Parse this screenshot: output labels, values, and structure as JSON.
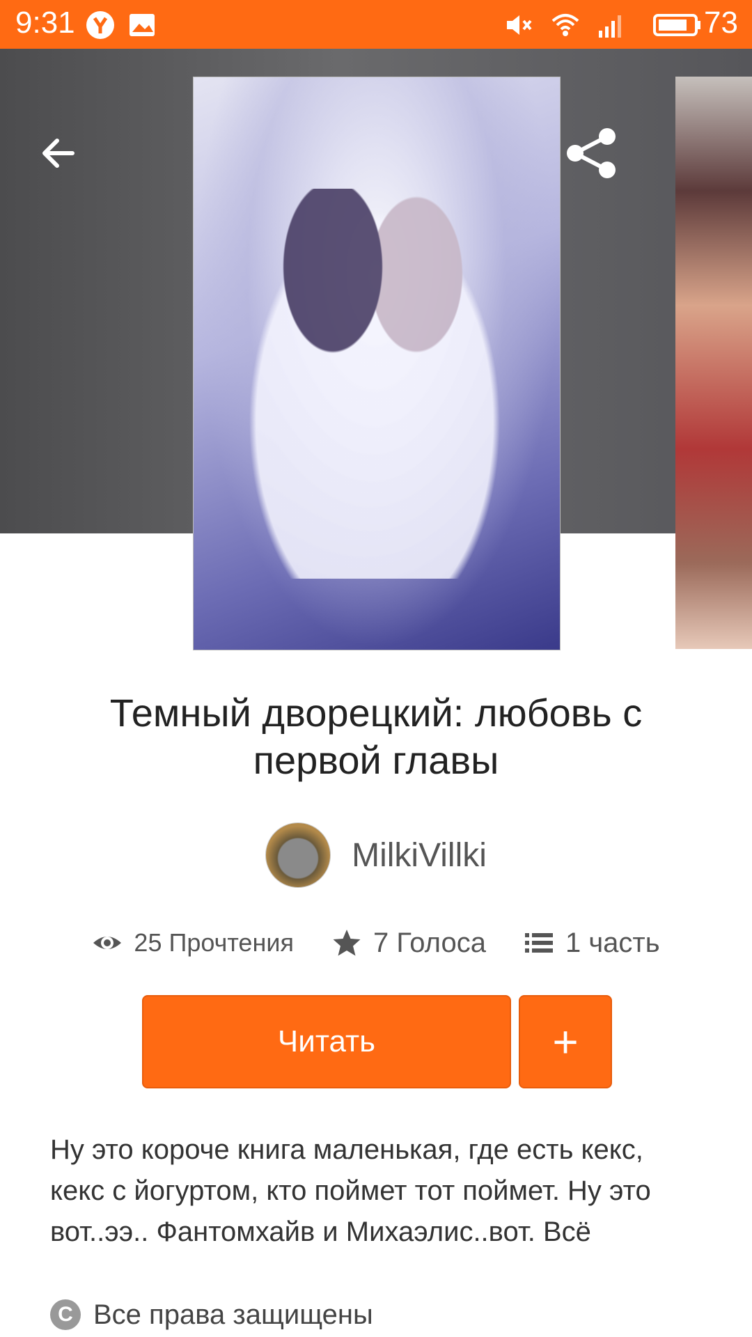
{
  "status_bar": {
    "time": "9:31",
    "battery_level": "73",
    "icons": [
      "yandex-icon",
      "image-icon",
      "mute-icon",
      "wifi-icon",
      "signal-icon",
      "battery-icon"
    ]
  },
  "header": {
    "back_icon": "arrow-left-icon",
    "share_icon": "share-icon",
    "more_icon": "more-vertical-icon"
  },
  "story": {
    "title": "Темный дворецкий: любовь с первой главы",
    "author": "MilkiVillki",
    "stats": {
      "reads": "25 Прочтения",
      "votes": "7 Голоса",
      "parts": "1 часть"
    },
    "read_button_label": "Читать",
    "add_button_label": "+",
    "description": "Ну это короче книга маленькая, где есть кекс, кекс с йогуртом, кто поймет тот поймет. Ну это вот..ээ.. Фантомхайв и Михаэлис..вот. Всё",
    "rights": "Все права защищены"
  },
  "colors": {
    "accent": "#ff6a13",
    "header_bg": "#5a5a5c"
  }
}
